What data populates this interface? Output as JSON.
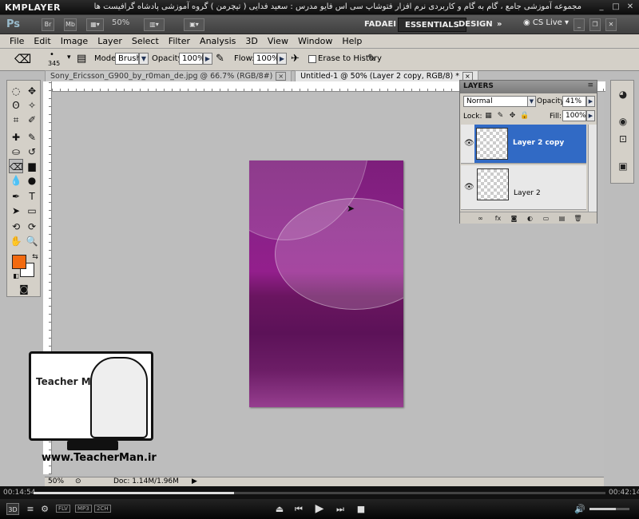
{
  "player": {
    "logo": "KMPLAYER",
    "caption": "مجموعه آموزشی جامع ، گام به گام و کاربردی نرم افزار فتوشاپ سی اس فایو مدرس : سعید فدایی ( تیچرمن ) گروه آموزشی پادشاه گرافیست ها",
    "time_elapsed": "00:14:54",
    "time_total": "00:42:14",
    "progress_fraction": 0.35,
    "volume_fraction": 0.66,
    "badges": [
      "3D",
      "FLV",
      "MP3",
      "2CH"
    ]
  },
  "appbar": {
    "logo": "Ps",
    "bridge_label": "Br",
    "minibridge_label": "Mb",
    "zoom": "50%",
    "workspaces": [
      "FADAEI",
      "ESSENTIALS",
      "DESIGN"
    ],
    "active_workspace": "ESSENTIALS",
    "cs_live": "CS Live"
  },
  "menu": [
    "File",
    "Edit",
    "Image",
    "Layer",
    "Select",
    "Filter",
    "Analysis",
    "3D",
    "View",
    "Window",
    "Help"
  ],
  "options": {
    "brush_size": "345",
    "mode_label": "Mode:",
    "mode_value": "Brush",
    "opacity_label": "Opacity:",
    "opacity_value": "100%",
    "flow_label": "Flow:",
    "flow_value": "100%",
    "erase_history_label": "Erase to History"
  },
  "doc_tabs": [
    {
      "label": "Sony_Ericsson_G900_by_r0man_de.jpg @ 66.7% (RGB/8#)"
    },
    {
      "label": "Untitled-1 @ 50% (Layer 2 copy, RGB/8) *"
    }
  ],
  "layers_panel": {
    "title": "LAYERS",
    "blend_mode": "Normal",
    "opacity_label": "Opacity:",
    "opacity_value": "41%",
    "lock_label": "Lock:",
    "fill_label": "Fill:",
    "fill_value": "100%",
    "layers": [
      {
        "name": "Layer 2 copy",
        "selected": true
      },
      {
        "name": "Layer 2",
        "selected": false
      }
    ]
  },
  "status": {
    "zoom": "50%",
    "doc_info": "Doc: 1.14M/1.96M"
  },
  "watermark": {
    "brand": "Teacher Man",
    "url": "www.TeacherMan.ir"
  },
  "colors": {
    "foreground": "#f26a10",
    "background": "#ffffff",
    "selection": "#316ac5"
  }
}
